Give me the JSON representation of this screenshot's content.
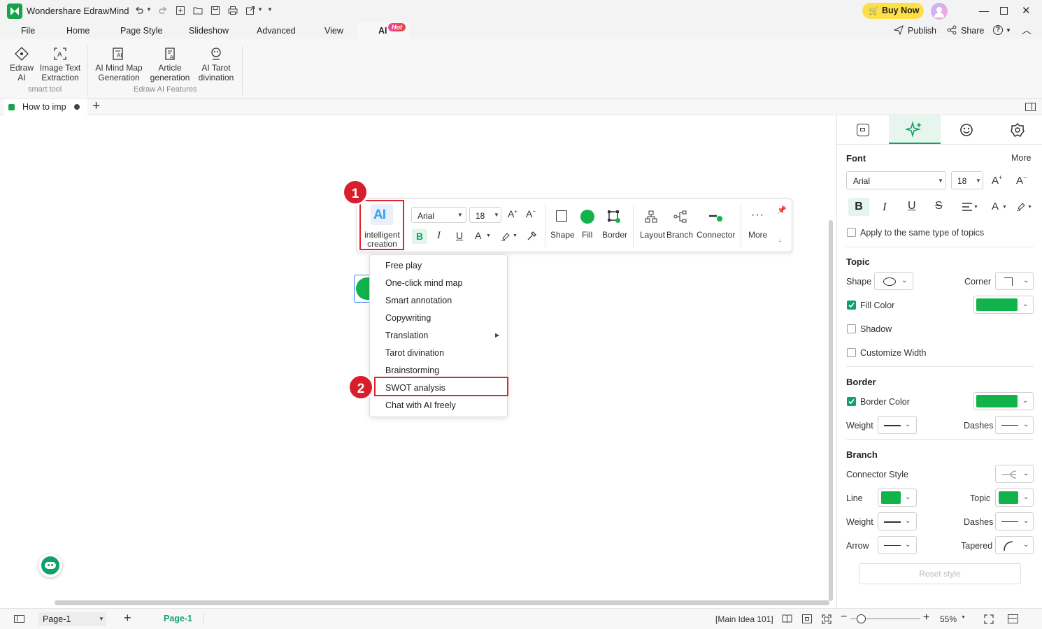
{
  "app": {
    "title": "Wondershare EdrawMind",
    "buy_now": "Buy Now",
    "publish": "Publish",
    "share": "Share"
  },
  "menu": {
    "items": [
      "File",
      "Home",
      "Page Style",
      "Slideshow",
      "Advanced",
      "View",
      "AI"
    ],
    "hot_badge": "Hot"
  },
  "ribbon": {
    "buttons": [
      {
        "label": "Edraw\nAI"
      },
      {
        "label": "Image Text\nExtraction"
      },
      {
        "label": "AI Mind Map\nGeneration"
      },
      {
        "label": "Article\ngeneration"
      },
      {
        "label": "AI Tarot\ndivination"
      }
    ],
    "group1_label": "smart tool",
    "group2_label": "Edraw AI Features"
  },
  "tabs": {
    "doc_tab": "How to imp"
  },
  "floating_toolbar": {
    "ai_label_line1": "intelligent",
    "ai_label_line2": "creation",
    "font": "Arial",
    "size": "18",
    "shape": "Shape",
    "fill": "Fill",
    "border": "Border",
    "layout": "Layout",
    "branch": "Branch",
    "connector": "Connector",
    "more": "More"
  },
  "dropdown": {
    "items": [
      "Free play",
      "One-click mind map",
      "Smart annotation",
      "Copywriting",
      "Translation",
      "Tarot divination",
      "Brainstorming",
      "SWOT analysis",
      "Chat with AI freely"
    ]
  },
  "badges": {
    "step1": "1",
    "step2": "2"
  },
  "right_panel": {
    "font_heading": "Font",
    "more": "More",
    "font": "Arial",
    "size": "18",
    "apply_same": "Apply to the same type of topics",
    "topic_heading": "Topic",
    "shape": "Shape",
    "corner": "Corner",
    "fill_color": "Fill Color",
    "shadow": "Shadow",
    "customize_width": "Customize Width",
    "border_heading": "Border",
    "border_color": "Border Color",
    "weight": "Weight",
    "dashes": "Dashes",
    "branch_heading": "Branch",
    "connector_style": "Connector Style",
    "line": "Line",
    "topic": "Topic",
    "weight2": "Weight",
    "dashes2": "Dashes",
    "arrow": "Arrow",
    "tapered": "Tapered",
    "reset_style": "Reset style"
  },
  "status": {
    "page_select": "Page-1",
    "page_tab": "Page-1",
    "main_idea": "[Main Idea 101]",
    "zoom": "55%"
  },
  "colors": {
    "accent_green": "#12b34a",
    "teal": "#12a06a",
    "red": "#d81e2c",
    "buy_yellow": "#fde047"
  }
}
